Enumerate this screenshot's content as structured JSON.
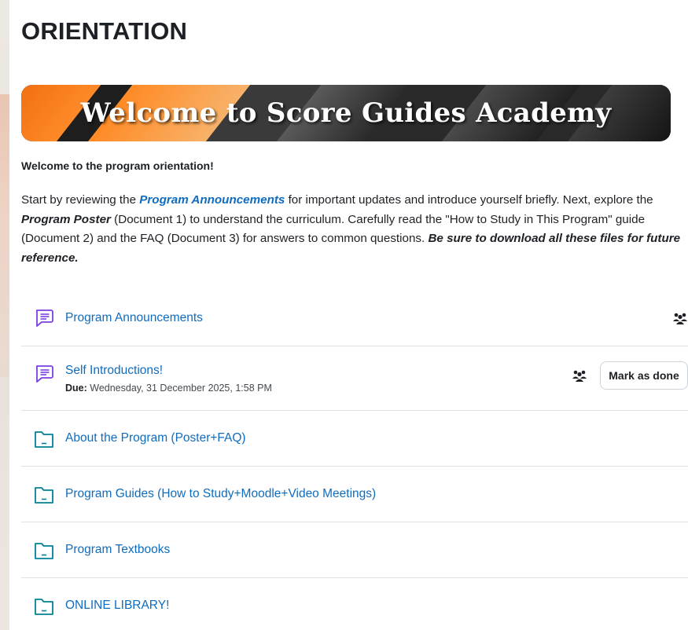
{
  "section": {
    "title": "ORIENTATION"
  },
  "banner": {
    "text": "Welcome to Score Guides Academy"
  },
  "intro": {
    "heading": "Welcome to the program orientation!",
    "p1": "Start by reviewing the ",
    "announcements_link": "Program Announcements",
    "p2": " for important updates and introduce yourself briefly. Next, explore the ",
    "poster": "Program Poster",
    "p3": " (Document 1) to understand the curriculum. Carefully read the \"How to Study in This Program\" guide (Document 2) and the FAQ (Document 3) for answers to common questions. ",
    "emphasis": "Be sure to download all these files for future reference."
  },
  "activities": [
    {
      "name": "Program Announcements",
      "icon": "forum-icon",
      "group_icon": "group-mode-icon"
    },
    {
      "name": "Self Introductions!",
      "icon": "forum-icon",
      "due_label": "Due:",
      "due_value": " Wednesday, 31 December 2025, 1:58 PM",
      "group_icon": "group-mode-icon",
      "button_label": "Mark as done"
    },
    {
      "name": "About the Program (Poster+FAQ)",
      "icon": "folder-icon"
    },
    {
      "name": "Program Guides (How to Study+Moodle+Video Meetings)",
      "icon": "folder-icon"
    },
    {
      "name": "Program Textbooks",
      "icon": "folder-icon"
    },
    {
      "name": "ONLINE LIBRARY!",
      "icon": "folder-icon"
    }
  ],
  "colors": {
    "link": "#0f6cbf",
    "forum_icon": "#7b3fe4",
    "folder_icon": "#008196",
    "banner_orange": "#f06d10"
  }
}
